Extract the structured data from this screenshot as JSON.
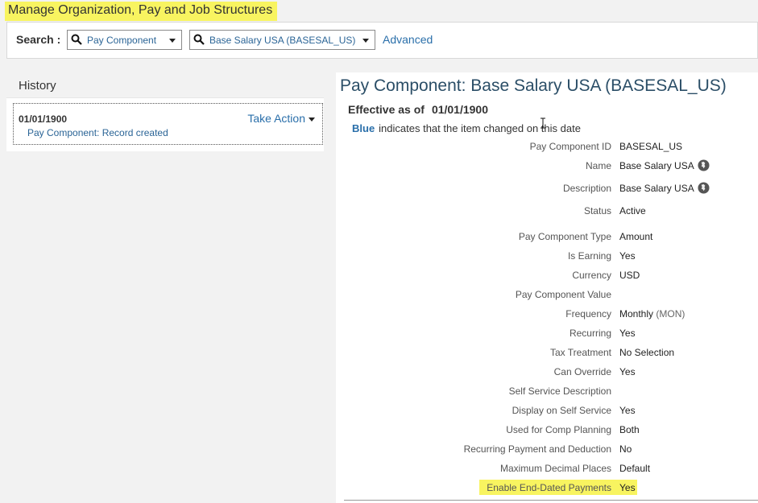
{
  "page": {
    "title": "Manage Organization, Pay and Job Structures"
  },
  "search": {
    "label": "Search :",
    "type_value": "Pay Component",
    "object_value": "Base Salary USA (BASESAL_US)",
    "advanced_link": "Advanced"
  },
  "history": {
    "title": "History",
    "entries": [
      {
        "date": "01/01/1900",
        "text": "Pay Component: Record created",
        "action": "Take Action"
      }
    ]
  },
  "detail": {
    "title": "Pay Component: Base Salary USA (BASESAL_US)",
    "effective_label": "Effective as of",
    "effective_date": "01/01/1900",
    "blue_word": "Blue",
    "blue_note": "indicates that the item changed on this date",
    "fields": [
      {
        "label": "Pay Component ID",
        "value": "BASESAL_US"
      },
      {
        "label": "Name",
        "value": "Base Salary USA",
        "icon": "globe-icon"
      },
      {
        "label": "Description",
        "value": "Base Salary USA",
        "icon": "globe-icon"
      },
      {
        "label": "Status",
        "value": "Active"
      },
      {
        "label": "Pay Component Type",
        "value": "Amount"
      },
      {
        "label": "Is Earning",
        "value": "Yes"
      },
      {
        "label": "Currency",
        "value": "USD"
      },
      {
        "label": "Pay Component Value",
        "value": ""
      },
      {
        "label": "Frequency",
        "value": "Monthly",
        "value_extra": "(MON)"
      },
      {
        "label": "Recurring",
        "value": "Yes"
      },
      {
        "label": "Tax Treatment",
        "value": "No Selection"
      },
      {
        "label": "Can Override",
        "value": "Yes"
      },
      {
        "label": "Self Service Description",
        "value": ""
      },
      {
        "label": "Display on Self Service",
        "value": "Yes"
      },
      {
        "label": "Used for Comp Planning",
        "value": "Both"
      },
      {
        "label": "Recurring Payment and Deduction",
        "value": "No"
      },
      {
        "label": "Maximum Decimal Places",
        "value": "Default"
      },
      {
        "label": "Enable End-Dated Payments",
        "value": "Yes"
      }
    ]
  },
  "colors": {
    "highlight": "#f8f460",
    "link": "#2a6faa",
    "title": "#2b4e67"
  }
}
